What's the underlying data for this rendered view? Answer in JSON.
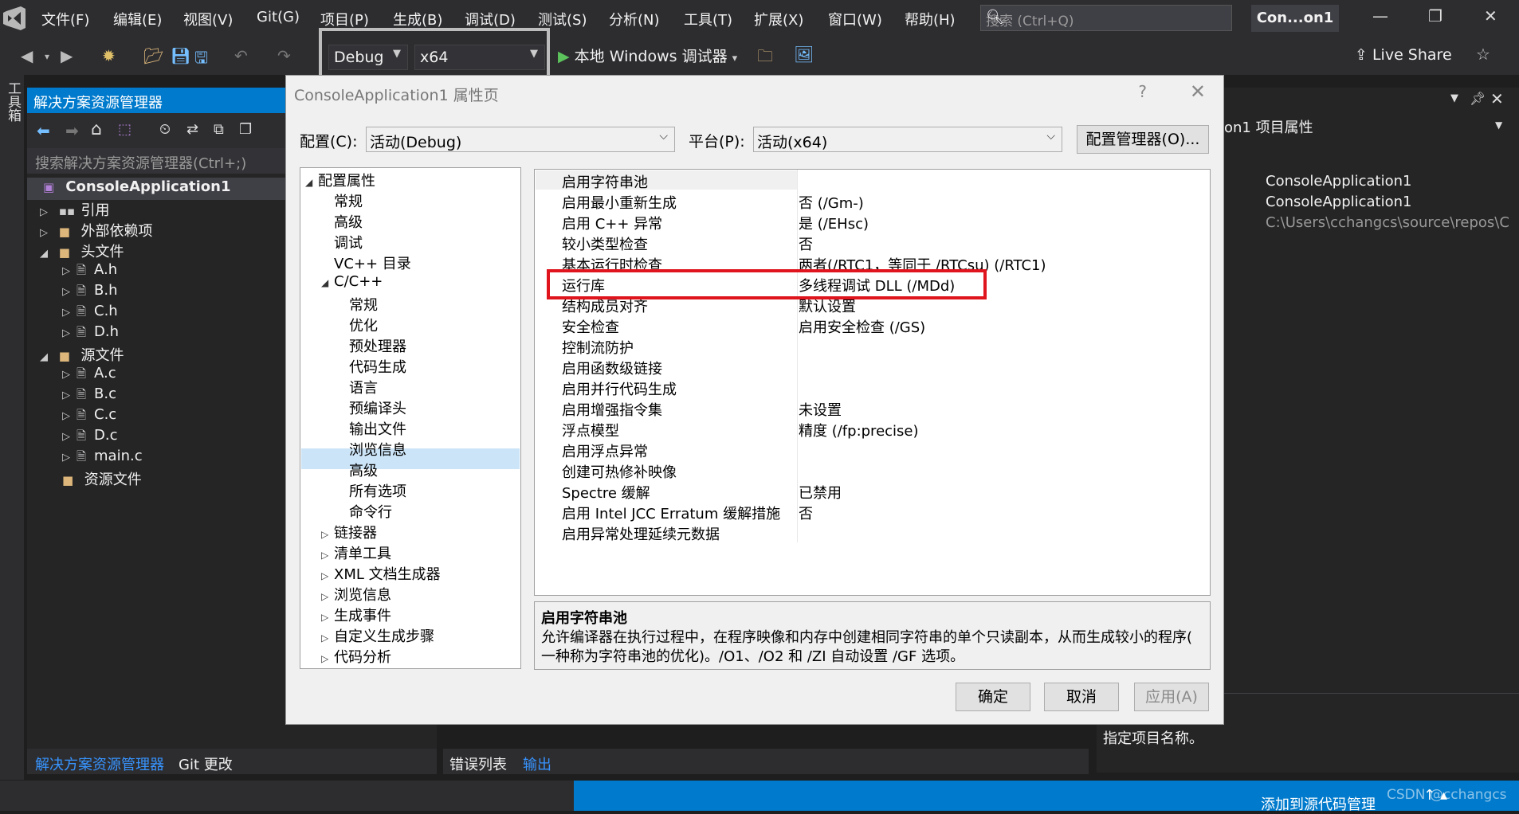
{
  "menubar": {
    "items": [
      "文件(F)",
      "编辑(E)",
      "视图(V)",
      "Git(G)",
      "项目(P)",
      "生成(B)",
      "调试(D)",
      "测试(S)",
      "分析(N)",
      "工具(T)",
      "扩展(X)",
      "窗口(W)",
      "帮助(H)"
    ],
    "search_placeholder": "搜索 (Ctrl+Q)",
    "app_badge": "Con...on1"
  },
  "toolbar": {
    "config": "Debug",
    "platform": "x64",
    "debugger": "本地 Windows 调试器",
    "live_share": "Live Share"
  },
  "toolbox_label": "工具箱",
  "solution_explorer": {
    "title": "解决方案资源管理器",
    "search_placeholder": "搜索解决方案资源管理器(Ctrl+;)",
    "project": "ConsoleApplication1",
    "references": "引用",
    "external_deps": "外部依赖项",
    "headers_folder": "头文件",
    "headers": [
      "A.h",
      "B.h",
      "C.h",
      "D.h"
    ],
    "sources_folder": "源文件",
    "sources": [
      "A.c",
      "B.c",
      "C.c",
      "D.c",
      "main.c"
    ],
    "resources_folder": "资源文件",
    "tab_active": "解决方案资源管理器",
    "tab_git": "Git 更改"
  },
  "right_panel": {
    "title_suffix": "on1  项目属性",
    "values": [
      "ConsoleApplication1",
      "ConsoleApplication1",
      "C:\\Users\\cchangcs\\source\\repos\\Cor"
    ],
    "description": "指定项目名称。"
  },
  "output_tabs": [
    "错误列表",
    "输出"
  ],
  "status": {
    "source_control": "添加到源代码管理",
    "watermark": "CSDN @cchangcs"
  },
  "dialog": {
    "title": "ConsoleApplication1 属性页",
    "help": "?",
    "config_label": "配置(C):",
    "config_value": "活动(Debug)",
    "platform_label": "平台(P):",
    "platform_value": "活动(x64)",
    "config_manager": "配置管理器(O)...",
    "tree": {
      "root": "配置属性",
      "general": "常规",
      "advanced": "高级",
      "debugging": "调试",
      "vcdirs": "VC++ 目录",
      "cpp": "C/C++",
      "cpp_children": [
        "常规",
        "优化",
        "预处理器",
        "代码生成",
        "语言",
        "预编译头",
        "输出文件",
        "浏览信息",
        "高级",
        "所有选项",
        "命令行"
      ],
      "collapsed": [
        "链接器",
        "清单工具",
        "XML 文档生成器",
        "浏览信息",
        "生成事件",
        "自定义生成步骤",
        "代码分析"
      ]
    },
    "properties": [
      {
        "name": "启用字符串池",
        "value": ""
      },
      {
        "name": "启用最小重新生成",
        "value": "否 (/Gm-)"
      },
      {
        "name": "启用 C++ 异常",
        "value": "是 (/EHsc)"
      },
      {
        "name": "较小类型检查",
        "value": "否"
      },
      {
        "name": "基本运行时检查",
        "value": "两者(/RTC1，等同于 /RTCsu) (/RTC1)"
      },
      {
        "name": "运行库",
        "value": "多线程调试 DLL (/MDd)"
      },
      {
        "name": "结构成员对齐",
        "value": "默认设置"
      },
      {
        "name": "安全检查",
        "value": "启用安全检查 (/GS)"
      },
      {
        "name": "控制流防护",
        "value": ""
      },
      {
        "name": "启用函数级链接",
        "value": ""
      },
      {
        "name": "启用并行代码生成",
        "value": ""
      },
      {
        "name": "启用增强指令集",
        "value": "未设置"
      },
      {
        "name": "浮点模型",
        "value": "精度 (/fp:precise)"
      },
      {
        "name": "启用浮点异常",
        "value": ""
      },
      {
        "name": "创建可热修补映像",
        "value": ""
      },
      {
        "name": "Spectre 缓解",
        "value": "已禁用"
      },
      {
        "name": "启用 Intel JCC Erratum 缓解措施",
        "value": "否"
      },
      {
        "name": "启用异常处理延续元数据",
        "value": ""
      }
    ],
    "desc_title": "启用字符串池",
    "desc_line1": "允许编译器在执行过程中，在程序映像和内存中创建相同字符串的单个只读副本，从而生成较小的程序(",
    "desc_line2": "一种称为字符串池的优化)。/O1、/O2 和 /ZI 自动设置 /GF 选项。",
    "ok": "确定",
    "cancel": "取消",
    "apply": "应用(A)"
  }
}
